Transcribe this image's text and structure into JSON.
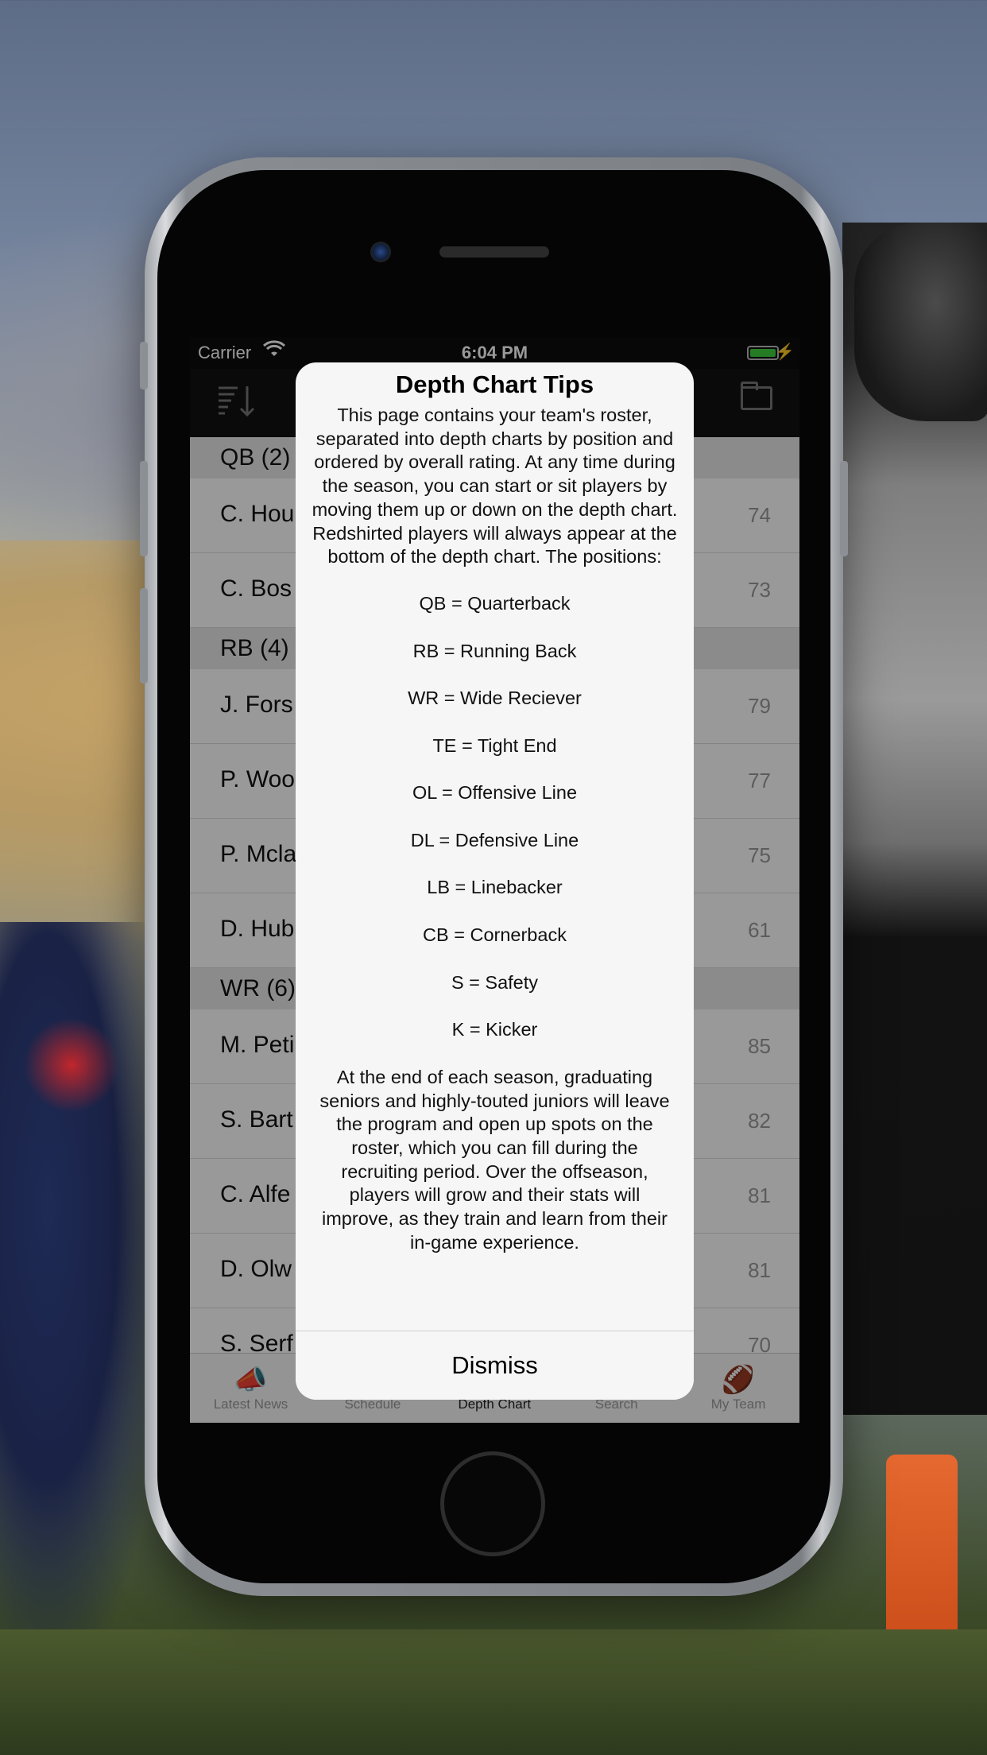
{
  "status_bar": {
    "carrier": "Carrier",
    "time": "6:04 PM"
  },
  "roster": {
    "sections": [
      {
        "header": "QB (2)",
        "players": [
          {
            "name": "C. Hou",
            "rating": "74"
          },
          {
            "name": "C. Bos",
            "rating": "73"
          }
        ]
      },
      {
        "header": "RB (4)",
        "players": [
          {
            "name": "J. Fors",
            "rating": "79"
          },
          {
            "name": "P. Woo",
            "rating": "77"
          },
          {
            "name": "P. Mcla",
            "rating": "75"
          },
          {
            "name": "D. Hub",
            "rating": "61"
          }
        ]
      },
      {
        "header": "WR (6)",
        "players": [
          {
            "name": "M. Peti",
            "rating": "85"
          },
          {
            "name": "S. Bart",
            "rating": "82"
          },
          {
            "name": "C. Alfe",
            "rating": "81"
          },
          {
            "name": "D. Olw",
            "rating": "81"
          },
          {
            "name": "S. Serf",
            "rating": "70"
          }
        ]
      }
    ]
  },
  "tabs": [
    {
      "label": "Latest News",
      "icon": "megaphone-icon",
      "glyph": "📣"
    },
    {
      "label": "Schedule",
      "icon": "calendar-icon",
      "glyph": ""
    },
    {
      "label": "Depth Chart",
      "icon": "depth-chart-icon",
      "glyph": ""
    },
    {
      "label": "Search",
      "icon": "search-icon",
      "glyph": ""
    },
    {
      "label": "My Team",
      "icon": "football-icon",
      "glyph": "🏈"
    }
  ],
  "alert": {
    "title": "Depth Chart Tips",
    "intro": "This page contains your team's roster, separated into depth charts by position and ordered by overall rating. At any time during the season, you can start or sit players by moving them up or down on the depth chart. Redshirted players will always appear at the bottom of the depth chart. The positions:",
    "positions": [
      "QB = Quarterback",
      "RB = Running Back",
      "WR = Wide Reciever",
      "TE = Tight End",
      "OL = Offensive Line",
      "DL = Defensive Line",
      "LB = Linebacker",
      "CB = Cornerback",
      "S = Safety",
      "K = Kicker"
    ],
    "outro": "At the end of each season, graduating seniors and highly-touted juniors will leave the program and open up spots on the roster, which you can fill during the recruiting period. Over the offseason, players will grow and their stats will improve, as they train and learn from their in-game experience.",
    "dismiss_label": "Dismiss"
  }
}
